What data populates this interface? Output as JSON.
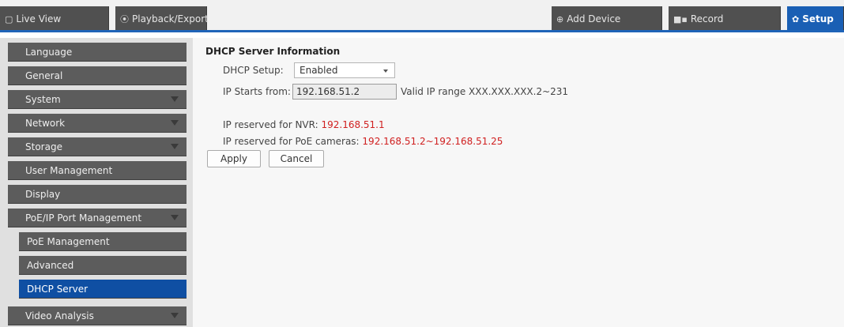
{
  "topbar": {
    "tabs": [
      {
        "label": "Live View",
        "icon": "square-icon"
      },
      {
        "label": "Playback/Export",
        "icon": "play-circle-icon"
      },
      {
        "label": "Add Device",
        "icon": "plus-circle-icon"
      },
      {
        "label": "Record",
        "icon": "camera-icon"
      },
      {
        "label": "Setup",
        "icon": "gear-icon",
        "active": true
      }
    ],
    "icon_glyphs": {
      "live": "▢",
      "playback": "⦿",
      "add": "⊕",
      "record": "■▪",
      "setup": "✿"
    }
  },
  "sidebar": {
    "items": [
      {
        "label": "Language"
      },
      {
        "label": "General"
      },
      {
        "label": "System",
        "expandable": true
      },
      {
        "label": "Network",
        "expandable": true
      },
      {
        "label": "Storage",
        "expandable": true
      },
      {
        "label": "User Management"
      },
      {
        "label": "Display"
      },
      {
        "label": "PoE/IP Port Management",
        "expandable": true
      },
      {
        "label": "PoE Management",
        "sub": true
      },
      {
        "label": "Advanced",
        "sub": true
      },
      {
        "label": "DHCP Server",
        "sub": true,
        "selected": true
      },
      {
        "label": "Video Analysis",
        "expandable": true
      }
    ]
  },
  "main": {
    "section_title": "DHCP Server Information",
    "dhcp_setup_label": "DHCP Setup:",
    "dhcp_setup_value": "Enabled",
    "ip_start_label": "IP Starts from:",
    "ip_start_value": "192.168.51.2",
    "valid_range_text": "Valid IP range XXX.XXX.XXX.2~231",
    "nvr_reserved_label": "IP reserved for NVR:",
    "nvr_reserved_value": "192.168.51.1",
    "poe_reserved_label": "IP reserved for PoE cameras:",
    "poe_reserved_value": "192.168.51.2~192.168.51.25",
    "apply_label": "Apply",
    "cancel_label": "Cancel"
  },
  "colors": {
    "accent": "#1a5fb4",
    "selected": "#0f4fa3",
    "sidebar_item": "#5c5c5c",
    "highlight_text": "#d02020"
  }
}
